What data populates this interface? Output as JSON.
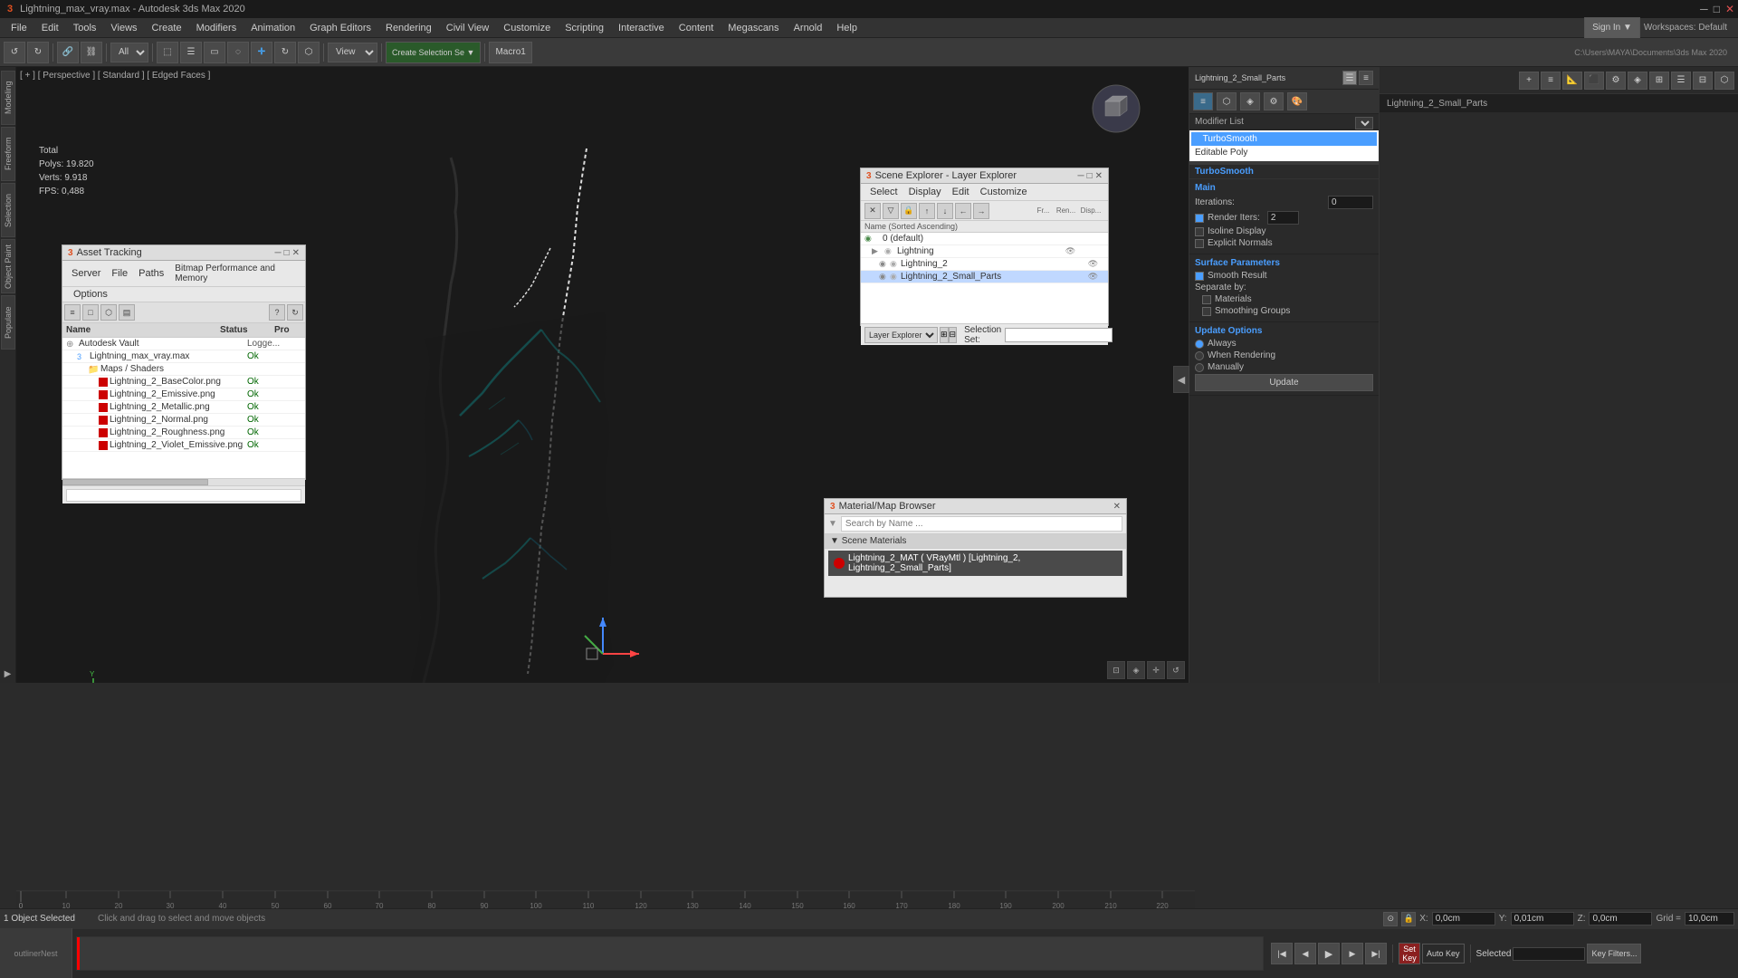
{
  "window": {
    "title": "Lightning_max_vray.max - Autodesk 3ds Max 2020",
    "controls": [
      "minimize",
      "maximize",
      "close"
    ]
  },
  "menu": {
    "items": [
      "File",
      "Edit",
      "Tools",
      "Views",
      "Create",
      "Modifiers",
      "Animation",
      "Graph Editors",
      "Rendering",
      "Civil View",
      "Customize",
      "Scripting",
      "Interactive",
      "Content",
      "Megascans",
      "Arnold",
      "Help"
    ]
  },
  "toolbar": {
    "mode_dropdown": "All",
    "view_dropdown": "View",
    "create_selection": "Create Selection Se",
    "macro": "Macro1",
    "workspace": "Workspaces: Default",
    "filepath": "C:\\Users\\MAYA\\Documents\\3ds Max 2020"
  },
  "viewport": {
    "label": "[ + ] [ Perspective ] [ Standard ] [ Edged Faces ]",
    "stats": {
      "total_label": "Total",
      "polys_label": "Polys:",
      "polys_value": "19.820",
      "verts_label": "Verts:",
      "verts_value": "9.918",
      "fps_label": "FPS:",
      "fps_value": "0,488"
    }
  },
  "scene_explorer": {
    "title": "Scene Explorer - Layer Explorer",
    "menus": [
      "Select",
      "Display",
      "Edit",
      "Customize"
    ],
    "columns": [
      "Name (Sorted Ascending)",
      "Fr...",
      "Ren...",
      "Display..."
    ],
    "rows": [
      {
        "name": "0 (default)",
        "level": 0,
        "type": "layer"
      },
      {
        "name": "Lightning",
        "level": 1,
        "type": "group"
      },
      {
        "name": "Lightning_2",
        "level": 2,
        "type": "object"
      },
      {
        "name": "Lightning_2_Small_Parts",
        "level": 2,
        "type": "object",
        "selected": true
      }
    ],
    "footer": {
      "dropdown": "Layer Explorer",
      "selection_label": "Selection Set:"
    }
  },
  "asset_tracking": {
    "title": "Asset Tracking",
    "menus": [
      "Server",
      "File",
      "Paths",
      "Bitmap Performance and Memory",
      "Options"
    ],
    "columns": {
      "name": "Name",
      "status": "Status",
      "pro": "Pro"
    },
    "rows": [
      {
        "name": "Autodesk Vault",
        "level": 0,
        "type": "vault",
        "status": "Logge..."
      },
      {
        "name": "Lightning_max_vray.max",
        "level": 1,
        "type": "max",
        "status": "Ok"
      },
      {
        "name": "Maps / Shaders",
        "level": 2,
        "type": "folder"
      },
      {
        "name": "Lightning_2_BaseColor.png",
        "level": 3,
        "type": "map",
        "status": "Ok"
      },
      {
        "name": "Lightning_2_Emissive.png",
        "level": 3,
        "type": "map",
        "status": "Ok"
      },
      {
        "name": "Lightning_2_Metallic.png",
        "level": 3,
        "type": "map",
        "status": "Ok"
      },
      {
        "name": "Lightning_2_Normal.png",
        "level": 3,
        "type": "map",
        "status": "Ok"
      },
      {
        "name": "Lightning_2_Roughness.png",
        "level": 3,
        "type": "map",
        "status": "Ok"
      },
      {
        "name": "Lightning_2_Violet_Emissive.png",
        "level": 3,
        "type": "map",
        "status": "Ok"
      }
    ]
  },
  "material_browser": {
    "title": "Material/Map Browser",
    "search_placeholder": "Search by Name ...",
    "section": "Scene Materials",
    "materials": [
      {
        "name": "Lightning_2_MAT ( VRayMtl ) [Lightning_2, Lightning_2_Small_Parts]",
        "color": "#cc0000"
      }
    ]
  },
  "right_panel": {
    "lightning_parts": "Lightning_2_Small_Parts",
    "modifier_list_label": "Modifier List",
    "modifiers": [
      {
        "name": "TurboSmooth",
        "active": true
      },
      {
        "name": "Editable Poly",
        "active": false
      }
    ],
    "turbosmooth": {
      "label": "TurboSmooth",
      "main_label": "Main",
      "iterations_label": "Iterations:",
      "iterations_value": "0",
      "render_iters_label": "Render Iters:",
      "render_iters_value": "2",
      "isoline_label": "Isoline Display",
      "explicit_label": "Explicit Normals",
      "surface_params_label": "Surface Parameters",
      "smooth_result_label": "Smooth Result",
      "separate_by_label": "Separate by:",
      "materials_label": "Materials",
      "smoothing_groups_label": "Smoothing Groups",
      "update_options_label": "Update Options",
      "always_label": "Always",
      "when_rendering_label": "When Rendering",
      "manually_label": "Manually",
      "update_btn": "Update"
    }
  },
  "status_bar": {
    "object_count": "1 Object Selected",
    "hint": "Click and drag to select and move objects",
    "x_label": "X:",
    "x_value": "0,0cm",
    "y_label": "Y:",
    "y_value": "0,01cm",
    "z_label": "Z:",
    "z_value": "0,0cm",
    "grid_label": "Grid =",
    "grid_value": "10,0cm",
    "selected_label": "Selected",
    "selected_value": "Selected",
    "key_filters": "Key Filters..."
  },
  "timeline": {
    "frame_start": "0",
    "frame_end": "225",
    "current_frame": "0",
    "ticks": [
      0,
      10,
      20,
      30,
      40,
      50,
      60,
      70,
      80,
      90,
      100,
      110,
      120,
      130,
      140,
      150,
      160,
      170,
      180,
      190,
      200,
      210,
      220
    ]
  },
  "side_tabs": [
    "Modeling",
    "Freeform",
    "Selection",
    "Object Paint",
    "Populate"
  ],
  "viewport_gizmo": "perspective-gizmo",
  "icons": {
    "close": "✕",
    "minimize": "─",
    "maximize": "□",
    "play": "▶",
    "pause": "⏸",
    "stop": "■",
    "prev": "◀◀",
    "next": "▶▶",
    "step_back": "◀",
    "step_fwd": "▶",
    "key": "⬦",
    "expand": "▶",
    "collapse": "◀",
    "folder": "📁",
    "eye": "👁",
    "lock": "🔒",
    "arrow_down": "▼",
    "arrow_right": "▶",
    "arrow_up": "▲",
    "plus": "+",
    "minus": "─",
    "gear": "⚙",
    "pin": "📌",
    "chain": "⛓",
    "filter": "▽",
    "move": "↕",
    "check": "✓",
    "lightbulb": "💡",
    "render": "🎬"
  }
}
